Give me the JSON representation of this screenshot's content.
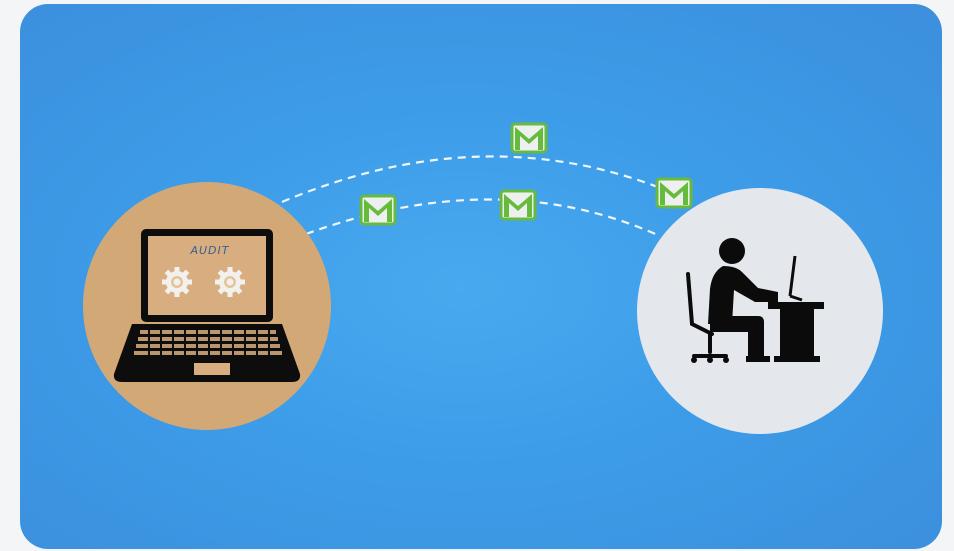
{
  "illustration": {
    "laptop_screen_brand": "AUDIT",
    "colors": {
      "background": "#3d9ce8",
      "laptop_circle": "#d3a877",
      "user_circle": "#e4e8ec",
      "email_icon_border": "#66bb3c",
      "email_icon_fill": "#eef0f0",
      "dashed_line": "#ffffff",
      "silhouette": "#0b0b0b"
    },
    "icons": [
      "laptop-icon",
      "gear-icon",
      "email-icon",
      "person-at-desk-icon",
      "office-chair-icon",
      "desk-icon",
      "monitor-icon"
    ]
  }
}
